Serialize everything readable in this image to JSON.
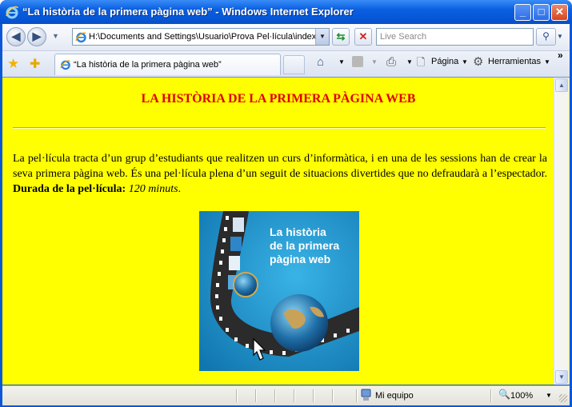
{
  "window": {
    "title": "“La història de la primera pàgina web” - Windows Internet Explorer",
    "minimize_label": "_",
    "maximize_label": "□",
    "close_label": "✕"
  },
  "toolbar": {
    "address": "H:\\Documents and Settings\\Usuario\\Prova Pel·lícula\\index.",
    "search_placeholder": "Live Search",
    "refresh_symbol": "⇆",
    "stop_symbol": "✕"
  },
  "tabs": {
    "active_label": "“La història de la primera pàgina web”"
  },
  "command_bar": {
    "page_label": "Página",
    "tools_label": "Herramientas"
  },
  "page": {
    "heading": "LA HISTÒRIA DE LA PRIMERA PÀGINA WEB",
    "paragraph": "La pel·lícula tracta d’un grup d’estudiants que realitzen un curs d’informàtica, i en una de les sessions han de crear la seva primera pàgina web. És una pel·lícula plena d’un seguit de situacions divertides que no defraudarà a l’espectador. ",
    "duration_label": "Durada de la pel·lícula:",
    "duration_value": "120 minuts",
    "duration_end": ".",
    "poster": {
      "title_line1": "La història",
      "title_line2": "de la primera",
      "title_line3": "pàgina web"
    }
  },
  "status": {
    "zone": "Mi equipo",
    "zoom": "100%"
  },
  "colors": {
    "page_background": "#ffff00",
    "heading": "#e00000",
    "poster_background": "#1d93c9"
  }
}
